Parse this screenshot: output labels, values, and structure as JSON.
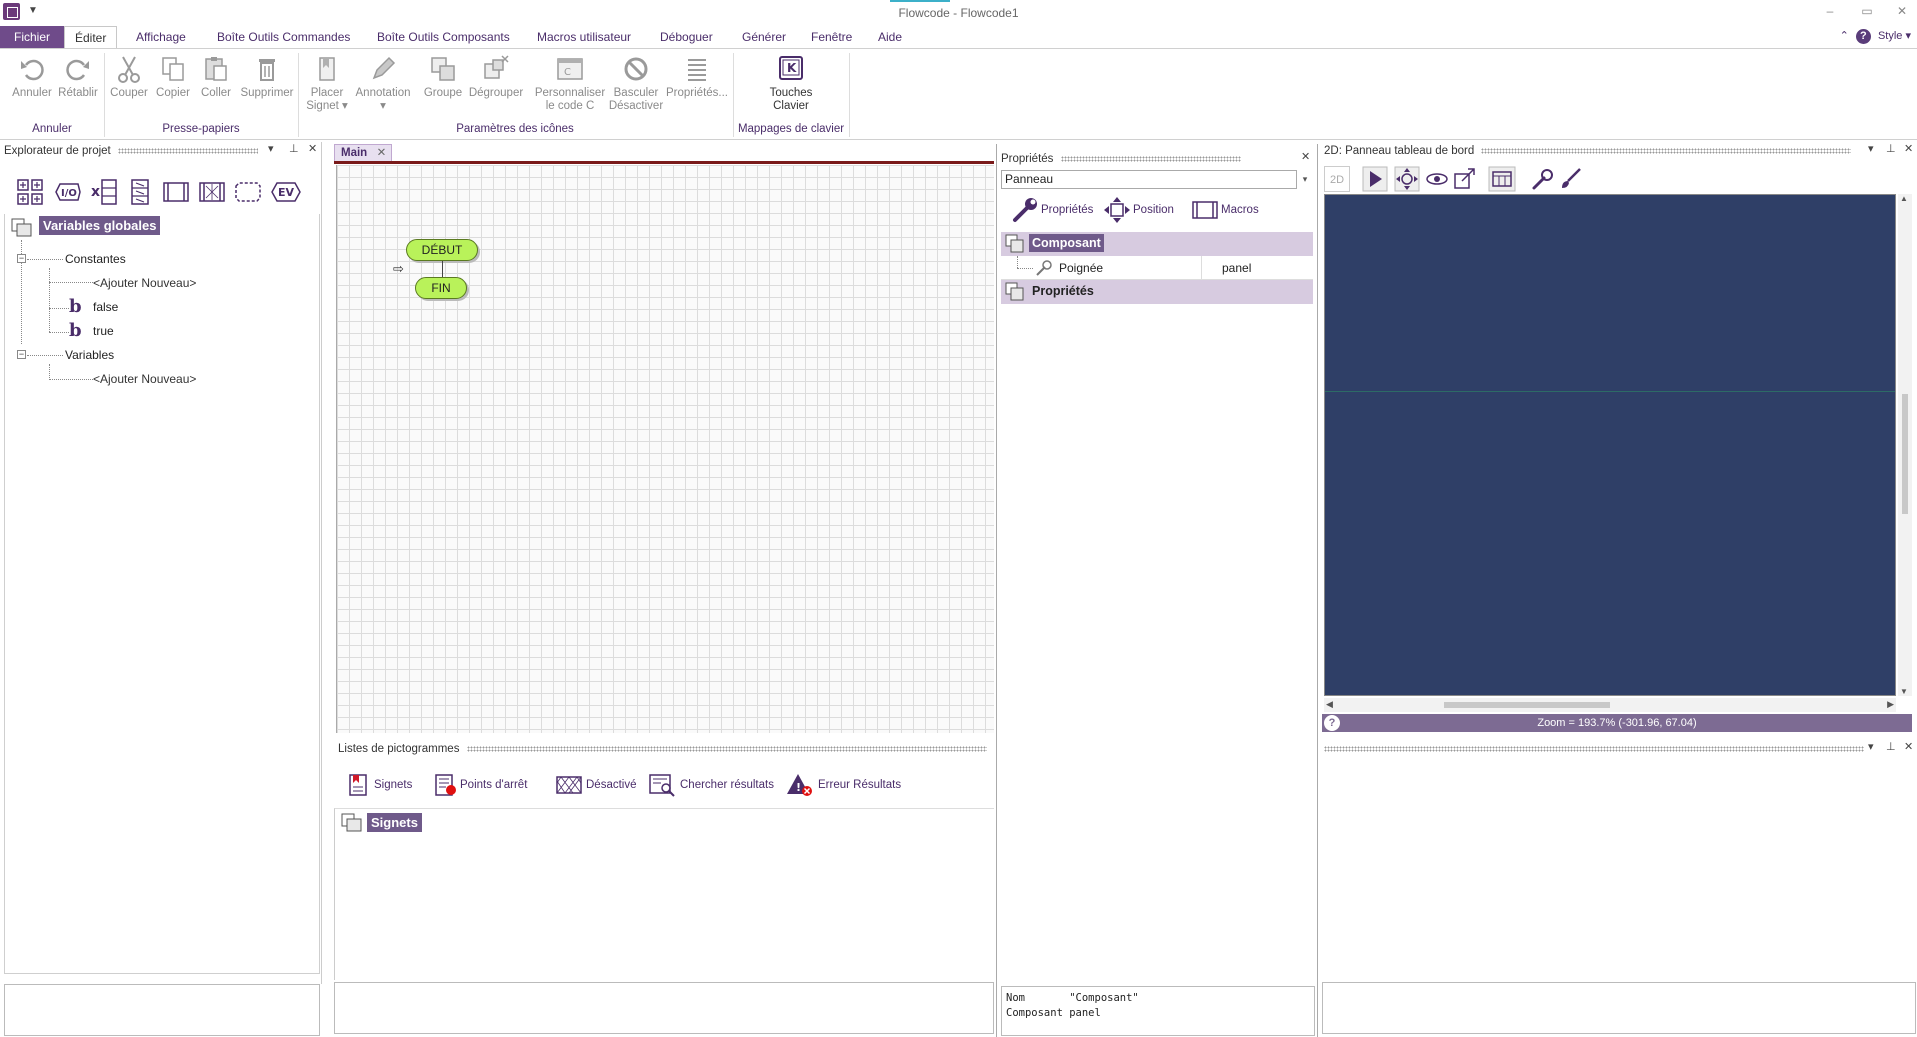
{
  "window": {
    "title": "Flowcode - Flowcode1",
    "quick_access": "▼",
    "minimize": "‒",
    "restore": "▭",
    "close": "✕"
  },
  "menu": {
    "tabs": [
      "Fichier",
      "Éditer",
      "Affichage",
      "Boîte Outils Commandes",
      "Boîte Outils Composants",
      "Macros utilisateur",
      "Déboguer",
      "Générer",
      "Fenêtre",
      "Aide"
    ],
    "active": "Éditer",
    "collapse": "⌃",
    "help": "?",
    "style_label": "Style",
    "style_arrow": "▾"
  },
  "ribbon": {
    "undo": "Annuler",
    "redo": "Rétablir",
    "group_undo": "Annuler",
    "cut": "Couper",
    "copy": "Copier",
    "paste": "Coller",
    "delete": "Supprimer",
    "group_clipboard": "Presse-papiers",
    "bookmark_line1": "Placer",
    "bookmark_line2": "Signet ▾",
    "annotation": "Annotation",
    "annotation_arrow": "▾",
    "group": "Groupe",
    "ungroup": "Dégrouper",
    "customize_line1": "Personnaliser",
    "customize_line2": "le code C",
    "toggle_line1": "Basculer",
    "toggle_line2": "Désactiver",
    "properties": "Propriétés...",
    "group_icons": "Paramètres des icônes",
    "keys_line1": "Touches",
    "keys_line2": "Clavier",
    "keys_letter": "K",
    "group_keys": "Mappages de clavier"
  },
  "explorer": {
    "title": "Explorateur de projet",
    "pin": "⊥",
    "dropdown": "▾",
    "close": "✕",
    "toolbar": [
      "grid",
      "I/O",
      "x-var",
      "array",
      "macro",
      "ports",
      "component",
      "EV"
    ],
    "io_label": "I/O",
    "x_label": "x",
    "ev_label": "EV",
    "root": "Variables globales",
    "constants": "Constantes",
    "add_new_1": "<Ajouter Nouveau>",
    "const_false": "false",
    "const_true": "true",
    "bool_glyph": "b",
    "variables": "Variables",
    "add_new_2": "<Ajouter Nouveau>",
    "toggle": "−"
  },
  "main": {
    "tab_label": "Main",
    "tab_close": "✕",
    "start_label": "DÉBUT",
    "end_label": "FIN",
    "arrow": "⇨"
  },
  "iconlists": {
    "title": "Listes de pictogrammes",
    "tabs": [
      "Signets",
      "Points d'arrêt",
      "Désactivé",
      "Chercher résultats",
      "Erreur Résultats"
    ],
    "root": "Signets"
  },
  "properties": {
    "title": "Propriétés",
    "close": "✕",
    "combo_value": "Panneau",
    "combo_arrow": "▾",
    "tabs": [
      "Propriétés",
      "Position",
      "Macros"
    ],
    "section1": "Composant",
    "row_name": "Poignée",
    "row_value": "panel",
    "section2": "Propriétés",
    "info_line1": "Nom       \"Composant\"",
    "info_line2": "Composant panel"
  },
  "panel2d": {
    "title": "2D: Panneau tableau de bord",
    "pin": "⊥",
    "dropdown": "▾",
    "close": "✕",
    "btn_2d": "2D",
    "status": "Zoom = 193.7% (-301.96, 67.04)",
    "help": "?",
    "scroll_left": "◀",
    "scroll_right": "▶",
    "scroll_up": "▲",
    "scroll_down": "▼"
  },
  "lower_right": {
    "pin": "⊥",
    "dropdown": "▾",
    "close": "✕"
  },
  "colors": {
    "accent": "#6f4b8a",
    "node_fill": "#b9f25a",
    "panel2d_bg": "#2f3f67",
    "status_bar": "#7d6b93"
  }
}
